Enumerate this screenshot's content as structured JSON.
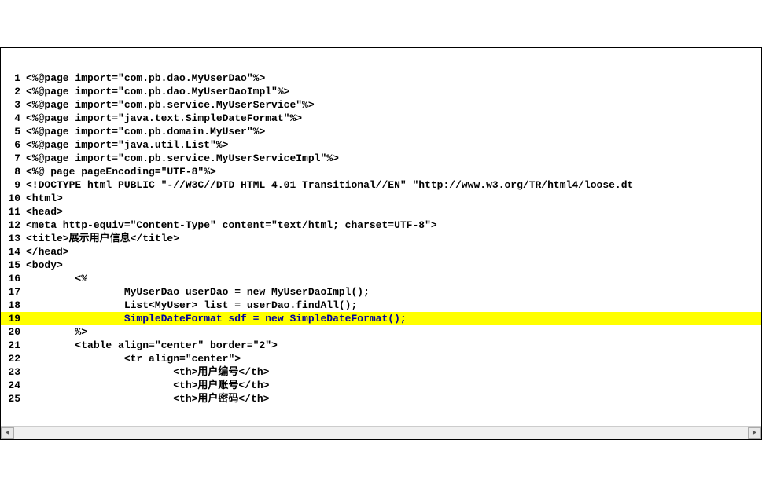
{
  "lines": [
    {
      "num": "1",
      "text": "<%@page import=\"com.pb.dao.MyUserDao\"%>",
      "hl": false
    },
    {
      "num": "2",
      "text": "<%@page import=\"com.pb.dao.MyUserDaoImpl\"%>",
      "hl": false
    },
    {
      "num": "3",
      "text": "<%@page import=\"com.pb.service.MyUserService\"%>",
      "hl": false
    },
    {
      "num": "4",
      "text": "<%@page import=\"java.text.SimpleDateFormat\"%>",
      "hl": false
    },
    {
      "num": "5",
      "text": "<%@page import=\"com.pb.domain.MyUser\"%>",
      "hl": false
    },
    {
      "num": "6",
      "text": "<%@page import=\"java.util.List\"%>",
      "hl": false
    },
    {
      "num": "7",
      "text": "<%@page import=\"com.pb.service.MyUserServiceImpl\"%>",
      "hl": false
    },
    {
      "num": "8",
      "text": "<%@ page pageEncoding=\"UTF-8\"%>",
      "hl": false
    },
    {
      "num": "9",
      "text": "<!DOCTYPE html PUBLIC \"-//W3C//DTD HTML 4.01 Transitional//EN\" \"http://www.w3.org/TR/html4/loose.dt",
      "hl": false
    },
    {
      "num": "10",
      "text": "<html>",
      "hl": false
    },
    {
      "num": "11",
      "text": "<head>",
      "hl": false
    },
    {
      "num": "12",
      "text": "<meta http-equiv=\"Content-Type\" content=\"text/html; charset=UTF-8\">",
      "hl": false
    },
    {
      "num": "13",
      "text": "<title>展示用户信息</title>",
      "hl": false
    },
    {
      "num": "14",
      "text": "</head>",
      "hl": false
    },
    {
      "num": "15",
      "text": "<body>",
      "hl": false
    },
    {
      "num": "16",
      "text": "        <%",
      "hl": false
    },
    {
      "num": "17",
      "text": "                MyUserDao userDao = new MyUserDaoImpl();",
      "hl": false
    },
    {
      "num": "18",
      "text": "                List<MyUser> list = userDao.findAll();",
      "hl": false
    },
    {
      "num": "19",
      "text": "                SimpleDateFormat sdf = new SimpleDateFormat();",
      "hl": true
    },
    {
      "num": "20",
      "text": "        %>",
      "hl": false
    },
    {
      "num": "21",
      "text": "        <table align=\"center\" border=\"2\">",
      "hl": false
    },
    {
      "num": "22",
      "text": "                <tr align=\"center\">",
      "hl": false
    },
    {
      "num": "23",
      "text": "                        <th>用户编号</th>",
      "hl": false
    },
    {
      "num": "24",
      "text": "                        <th>用户账号</th>",
      "hl": false
    },
    {
      "num": "25",
      "text": "                        <th>用户密码</th>",
      "hl": false
    }
  ],
  "scroll": {
    "left_arrow": "◄",
    "right_arrow": "►"
  }
}
